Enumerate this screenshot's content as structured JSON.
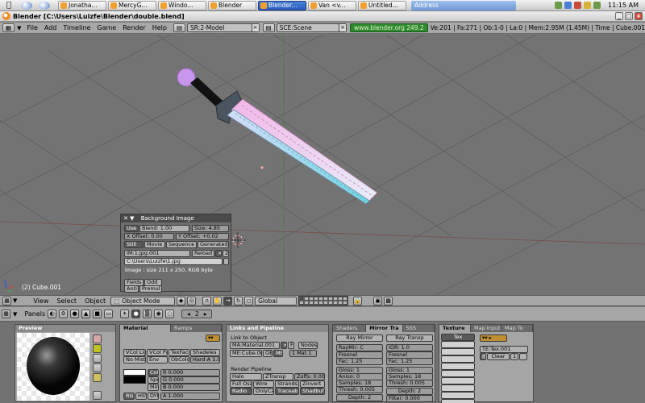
{
  "taskbar": {
    "tasks": [
      {
        "label": "Jonatha..."
      },
      {
        "label": "MercyG..."
      },
      {
        "label": "Windo..."
      },
      {
        "label": "Blender"
      },
      {
        "label": "Blender...",
        "active": true
      },
      {
        "label": "Van <v..."
      },
      {
        "label": "Untitled..."
      }
    ],
    "address": "Address",
    "clock": "11:15 AM"
  },
  "window": {
    "title": "Blender [C:\\Users\\Luizfe\\Blender\\double.blend]"
  },
  "info_header": {
    "menus": [
      "File",
      "Add",
      "Timeline",
      "Game",
      "Render",
      "Help"
    ],
    "screen": "SR:2-Model",
    "scene": "SCE:Scene",
    "url": "www.blender.org 249.2",
    "stats": "Ve:201 | Fa:271 | Ob:1-0 | La:0 | Mem:2.95M (1.45M) | Time | Cube.001"
  },
  "viewport": {
    "object_label": "(2) Cube.001"
  },
  "bg_panel": {
    "title": "Background Image",
    "use": "Use",
    "blend": "Blend: 1.00",
    "size": "Size: 4.85",
    "x_offset": "X Offset: 0.00",
    "y_offset": "Y Offset: +0.02",
    "tabs": [
      "Still",
      "Movie",
      "Sequence",
      "Generated"
    ],
    "image": "IM:1.jpg.001",
    "reload": "Reload",
    "users": "2",
    "path": "C:\\Users\\Luizfe\\1.jpg",
    "info": "Image : size 211 x 250, RGB byte",
    "fields": "Fields",
    "odd": "Odd",
    "anti": "Anti",
    "premul": "Premul"
  },
  "view_header": {
    "menus": [
      "View",
      "Select",
      "Object"
    ],
    "mode": "Object Mode",
    "orientation": "Global"
  },
  "buttons_header": {
    "panels_label": "Panels",
    "frame": "2"
  },
  "preview_panel": {
    "title": "Preview"
  },
  "material_panel": {
    "tabs": [
      "Material",
      "Ramps"
    ],
    "row1": [
      "VCol Lig",
      "VCol Pai",
      "TexFac",
      "Shadeles"
    ],
    "row2": [
      "No Mist",
      "Env",
      "ObColor",
      "Hard A 1.00"
    ],
    "col": "Col",
    "spe": "Spe",
    "mir": "Mir",
    "r": "R 0.000",
    "g": "G 0.000",
    "b": "B 0.000",
    "modes": [
      "RGB",
      "HSV",
      "DYN"
    ],
    "alpha": "A 1.000"
  },
  "links_panel": {
    "title": "Links and Pipeline",
    "link_label": "Link to Object",
    "material": "MA:Material.001",
    "f": "F",
    "nodes": "Nodes",
    "me": "ME:Cube.001",
    "ob": "OB",
    "me_btn": "ME",
    "mat_count": "1 Mat 1",
    "pipeline_label": "Render Pipeline",
    "pipe_row1": [
      "Halo",
      "ZTransp",
      "Zoffs: 0.00"
    ],
    "pipe_row2": [
      "Full Osa",
      "Wire",
      "Strands",
      "Zinvert"
    ],
    "pipe_row3": [
      "Radio",
      "OnlyCast",
      "Traceable",
      "Shadbuf"
    ]
  },
  "shaders_panel": {
    "tabs": [
      "Shaders",
      "Mirror Tra",
      "SSS"
    ],
    "ray_mirror": "Ray Mirror",
    "ray_transp": "Ray Transp",
    "raymir": "RayMir: C",
    "fresnel": "Fresnel",
    "fac_left": "Fac: 1.25",
    "gloss_left": "Gloss: 1",
    "aniso": "Aniso: 0",
    "samples_left": "Samples: 18",
    "thresh_left": "Thresh: 0.005",
    "depth_left": "Depth: 2",
    "ior": "IOR: 1.0",
    "fresnel_r": "Fresnel",
    "fac_right": "Fac: 1.25",
    "gloss_right": "Gloss: 1",
    "samples_right": "Samples: 18",
    "thresh_right": "Thresh: 0.005",
    "depth_right": "Depth: 2",
    "filter": "Filter: 0.000"
  },
  "texture_panel": {
    "tabs": [
      "Texture",
      "Map Input",
      "Map To"
    ],
    "tex": "Tex",
    "te": "TE:Tex.001",
    "clear": "Clear",
    "users": "1"
  }
}
